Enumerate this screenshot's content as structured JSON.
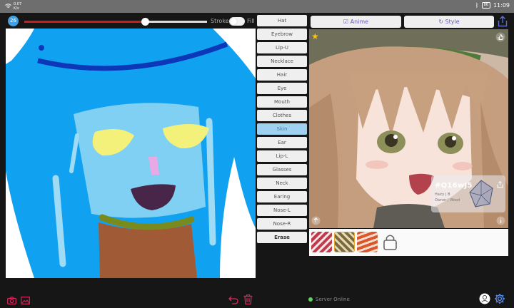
{
  "status_bar": {
    "left_top": "0.07",
    "left_bottom": "K/s",
    "time": "11:09",
    "battery": "86"
  },
  "toolbar": {
    "brush_size": "26",
    "stroke_label": "Stroke",
    "fill_label": "Fill",
    "slider_fraction": 0.66,
    "stroke_color": "#c81e1e"
  },
  "parts_menu": {
    "items": [
      {
        "label": "Hat",
        "active": false
      },
      {
        "label": "Eyebrow",
        "active": false
      },
      {
        "label": "Lip-U",
        "active": false
      },
      {
        "label": "Necklace",
        "active": false
      },
      {
        "label": "Hair",
        "active": false
      },
      {
        "label": "Eye",
        "active": false
      },
      {
        "label": "Mouth",
        "active": false
      },
      {
        "label": "Clothes",
        "active": false
      },
      {
        "label": "Skin",
        "active": true
      },
      {
        "label": "Ear",
        "active": false
      },
      {
        "label": "Lip-L",
        "active": false
      },
      {
        "label": "Glasses",
        "active": false
      },
      {
        "label": "Neck",
        "active": false
      },
      {
        "label": "Earing",
        "active": false
      },
      {
        "label": "Nose-L",
        "active": false
      },
      {
        "label": "Nose-R",
        "active": false
      },
      {
        "label": "Erase",
        "active": false
      }
    ]
  },
  "top_buttons": {
    "anime": "Anime",
    "style": "Style"
  },
  "result": {
    "seed_id": "#Q16wJ5",
    "line1": "Hairy | B",
    "line2": "Owner | Wood"
  },
  "footer": {
    "server_status": "Server Online"
  },
  "colors": {
    "accent": "#6a55c9",
    "skin_active": "#9fd2f0",
    "server_dot": "#5cd65c",
    "footer_icons": "#e0245e"
  }
}
